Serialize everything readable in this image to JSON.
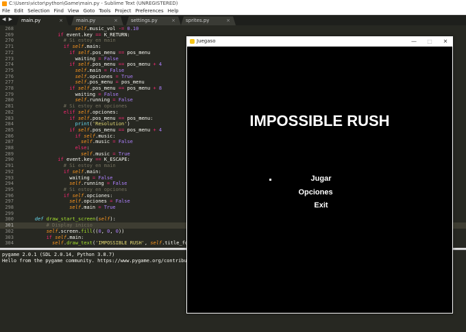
{
  "window": {
    "title": "C:\\Users\\victor\\python\\Game\\main.py - Sublime Text (UNREGISTERED)"
  },
  "menu": [
    "File",
    "Edit",
    "Selection",
    "Find",
    "View",
    "Goto",
    "Tools",
    "Project",
    "Preferences",
    "Help"
  ],
  "tabs": [
    {
      "label": "main.py",
      "active": true
    },
    {
      "label": "main.py",
      "active": false
    },
    {
      "label": "settings.py",
      "active": false
    },
    {
      "label": "sprites.py",
      "active": false
    }
  ],
  "tab_close_glyph": "×",
  "tab_nav_glyph": "◀ ▶",
  "editor": {
    "current_line": 301,
    "lines": [
      {
        "n": 268,
        "i": 18,
        "t": [
          [
            "sf",
            "self"
          ],
          [
            "",
            "."
          ],
          [
            "",
            "music_vol "
          ],
          [
            "kw",
            "-="
          ],
          [
            "nm",
            " 0.10"
          ]
        ]
      },
      {
        "n": 269,
        "i": 12,
        "t": [
          [
            "kw",
            "if"
          ],
          [
            "",
            " event.key "
          ],
          [
            "kw",
            "=="
          ],
          [
            "",
            " K_RETURN:"
          ]
        ]
      },
      {
        "n": 270,
        "i": 14,
        "t": [
          [
            "cm",
            "# Si estoy en main"
          ]
        ]
      },
      {
        "n": 271,
        "i": 14,
        "t": [
          [
            "kw",
            "if"
          ],
          [
            "",
            " "
          ],
          [
            "sf",
            "self"
          ],
          [
            "",
            ".main:"
          ]
        ]
      },
      {
        "n": 272,
        "i": 16,
        "t": [
          [
            "kw",
            "if"
          ],
          [
            "",
            " "
          ],
          [
            "sf",
            "self"
          ],
          [
            "",
            ".pos_menu "
          ],
          [
            "kw",
            "=="
          ],
          [
            "",
            " pos_menu"
          ]
        ]
      },
      {
        "n": 273,
        "i": 18,
        "t": [
          [
            "",
            "waiting "
          ],
          [
            "kw",
            "="
          ],
          [
            "",
            " "
          ],
          [
            "nm",
            "False"
          ]
        ]
      },
      {
        "n": 274,
        "i": 16,
        "t": [
          [
            "kw",
            "if"
          ],
          [
            "",
            " "
          ],
          [
            "sf",
            "self"
          ],
          [
            "",
            ".pos_menu "
          ],
          [
            "kw",
            "=="
          ],
          [
            "",
            " pos_menu "
          ],
          [
            "kw",
            "+"
          ],
          [
            "nm",
            " 4"
          ]
        ]
      },
      {
        "n": 275,
        "i": 18,
        "t": [
          [
            "sf",
            "self"
          ],
          [
            "",
            ".main "
          ],
          [
            "kw",
            "="
          ],
          [
            "",
            " "
          ],
          [
            "nm",
            "False"
          ]
        ]
      },
      {
        "n": 276,
        "i": 18,
        "t": [
          [
            "sf",
            "self"
          ],
          [
            "",
            ".opciones "
          ],
          [
            "kw",
            "="
          ],
          [
            "",
            " "
          ],
          [
            "nm",
            "True"
          ]
        ]
      },
      {
        "n": 277,
        "i": 18,
        "t": [
          [
            "sf",
            "self"
          ],
          [
            "",
            ".pos_menu "
          ],
          [
            "kw",
            "="
          ],
          [
            "",
            " pos_menu"
          ]
        ]
      },
      {
        "n": 278,
        "i": 16,
        "t": [
          [
            "kw",
            "if"
          ],
          [
            "",
            " "
          ],
          [
            "sf",
            "self"
          ],
          [
            "",
            ".pos_menu "
          ],
          [
            "kw",
            "=="
          ],
          [
            "",
            " pos_menu "
          ],
          [
            "kw",
            "+"
          ],
          [
            "nm",
            " 8"
          ]
        ]
      },
      {
        "n": 279,
        "i": 18,
        "t": [
          [
            "",
            "waiting "
          ],
          [
            "kw",
            "="
          ],
          [
            "",
            " "
          ],
          [
            "nm",
            "False"
          ]
        ]
      },
      {
        "n": 280,
        "i": 18,
        "t": [
          [
            "sf",
            "self"
          ],
          [
            "",
            ".running "
          ],
          [
            "kw",
            "="
          ],
          [
            "",
            " "
          ],
          [
            "nm",
            "False"
          ]
        ]
      },
      {
        "n": 281,
        "i": 14,
        "t": [
          [
            "cm",
            "# Si estoy en opciones"
          ]
        ]
      },
      {
        "n": 282,
        "i": 14,
        "t": [
          [
            "kw",
            "elif"
          ],
          [
            "",
            " "
          ],
          [
            "sf",
            "self"
          ],
          [
            "",
            ".opciones:"
          ]
        ]
      },
      {
        "n": 283,
        "i": 16,
        "t": [
          [
            "kw",
            "if"
          ],
          [
            "",
            " "
          ],
          [
            "sf",
            "self"
          ],
          [
            "",
            ".pos_menu "
          ],
          [
            "kw",
            "=="
          ],
          [
            "",
            " pos_menu:"
          ]
        ]
      },
      {
        "n": 284,
        "i": 18,
        "t": [
          [
            "bi",
            "print"
          ],
          [
            "",
            "("
          ],
          [
            "st",
            "'Resolution'"
          ],
          [
            "",
            ")"
          ]
        ]
      },
      {
        "n": 285,
        "i": 16,
        "t": [
          [
            "kw",
            "if"
          ],
          [
            "",
            " "
          ],
          [
            "sf",
            "self"
          ],
          [
            "",
            ".pos_menu "
          ],
          [
            "kw",
            "=="
          ],
          [
            "",
            " pos_menu "
          ],
          [
            "kw",
            "+"
          ],
          [
            "nm",
            " 4"
          ]
        ]
      },
      {
        "n": 286,
        "i": 18,
        "t": [
          [
            "kw",
            "if"
          ],
          [
            "",
            " "
          ],
          [
            "sf",
            "self"
          ],
          [
            "",
            ".music:"
          ]
        ]
      },
      {
        "n": 287,
        "i": 20,
        "t": [
          [
            "sf",
            "self"
          ],
          [
            "",
            ".music "
          ],
          [
            "kw",
            "="
          ],
          [
            "",
            " "
          ],
          [
            "nm",
            "False"
          ]
        ]
      },
      {
        "n": 288,
        "i": 18,
        "t": [
          [
            "kw",
            "else"
          ],
          [
            "",
            ":"
          ]
        ]
      },
      {
        "n": 289,
        "i": 20,
        "t": [
          [
            "sf",
            "self"
          ],
          [
            "",
            ".music "
          ],
          [
            "kw",
            "="
          ],
          [
            "",
            " "
          ],
          [
            "nm",
            "True"
          ]
        ]
      },
      {
        "n": 290,
        "i": 12,
        "t": [
          [
            "kw",
            "if"
          ],
          [
            "",
            " event.key "
          ],
          [
            "kw",
            "=="
          ],
          [
            "",
            " K_ESCAPE:"
          ]
        ]
      },
      {
        "n": 291,
        "i": 14,
        "t": [
          [
            "cm",
            "# Si estoy en main"
          ]
        ]
      },
      {
        "n": 292,
        "i": 14,
        "t": [
          [
            "kw",
            "if"
          ],
          [
            "",
            " "
          ],
          [
            "sf",
            "self"
          ],
          [
            "",
            ".main:"
          ]
        ]
      },
      {
        "n": 293,
        "i": 16,
        "t": [
          [
            "",
            "waiting "
          ],
          [
            "kw",
            "="
          ],
          [
            "",
            " "
          ],
          [
            "nm",
            "False"
          ]
        ]
      },
      {
        "n": 294,
        "i": 16,
        "t": [
          [
            "sf",
            "self"
          ],
          [
            "",
            ".running "
          ],
          [
            "kw",
            "="
          ],
          [
            "",
            " "
          ],
          [
            "nm",
            "False"
          ]
        ]
      },
      {
        "n": 295,
        "i": 14,
        "t": [
          [
            "cm",
            "# Si estoy en opciones"
          ]
        ]
      },
      {
        "n": 296,
        "i": 14,
        "t": [
          [
            "kw",
            "if"
          ],
          [
            "",
            " "
          ],
          [
            "sf",
            "self"
          ],
          [
            "",
            ".opciones:"
          ]
        ]
      },
      {
        "n": 297,
        "i": 16,
        "t": [
          [
            "sf",
            "self"
          ],
          [
            "",
            ".opciones "
          ],
          [
            "kw",
            "="
          ],
          [
            "",
            " "
          ],
          [
            "nm",
            "False"
          ]
        ]
      },
      {
        "n": 298,
        "i": 16,
        "t": [
          [
            "sf",
            "self"
          ],
          [
            "",
            ".main "
          ],
          [
            "kw",
            "="
          ],
          [
            "",
            " "
          ],
          [
            "nm",
            "True"
          ]
        ]
      },
      {
        "n": 299,
        "i": 0,
        "t": []
      },
      {
        "n": 300,
        "i": 4,
        "t": [
          [
            "df",
            "def"
          ],
          [
            "",
            " "
          ],
          [
            "fn",
            "draw_start_screen"
          ],
          [
            "",
            "("
          ],
          [
            "sf",
            "self"
          ],
          [
            "",
            "):"
          ]
        ]
      },
      {
        "n": 301,
        "i": 8,
        "t": [
          [
            "cm",
            "# Display inicio"
          ]
        ]
      },
      {
        "n": 302,
        "i": 8,
        "t": [
          [
            "sf",
            "self"
          ],
          [
            "",
            ".screen."
          ],
          [
            "fn",
            "fill"
          ],
          [
            "",
            "(("
          ],
          [
            "nm",
            "0"
          ],
          [
            "",
            ", "
          ],
          [
            "nm",
            "0"
          ],
          [
            "",
            ", "
          ],
          [
            "nm",
            "0"
          ],
          [
            "",
            "))"
          ]
        ]
      },
      {
        "n": 303,
        "i": 8,
        "t": [
          [
            "kw",
            "if"
          ],
          [
            "",
            " "
          ],
          [
            "sf",
            "self"
          ],
          [
            "",
            ".main:"
          ]
        ]
      },
      {
        "n": 304,
        "i": 10,
        "t": [
          [
            "sf",
            "self"
          ],
          [
            "",
            "."
          ],
          [
            "fn",
            "draw_text"
          ],
          [
            "",
            "("
          ],
          [
            "st",
            "'IMPOSSIBLE RUSH'"
          ],
          [
            "",
            ", "
          ],
          [
            "sf",
            "self"
          ],
          [
            "",
            ".title_fo"
          ]
        ]
      }
    ]
  },
  "console": {
    "lines": [
      "pygame 2.0.1 (SDL 2.0.14, Python 3.8.7)",
      "Hello from the pygame community. https://www.pygame.org/contribute."
    ]
  },
  "pygame_window": {
    "title": "Juegaso",
    "minimize": "—",
    "maximize": "□",
    "close": "✕",
    "game_title": "IMPOSSIBLE RUSH",
    "menu": [
      "Jugar",
      "Opciones",
      "Exit"
    ],
    "selected_index": 0
  },
  "colors": {
    "editor_bg": "#272822",
    "keyword": "#f92672",
    "self": "#fd971f",
    "number": "#ae81ff",
    "string": "#e6db74",
    "comment": "#75715e",
    "function": "#a6e22e",
    "game_bg": "#000000",
    "game_text": "#ffffff"
  }
}
